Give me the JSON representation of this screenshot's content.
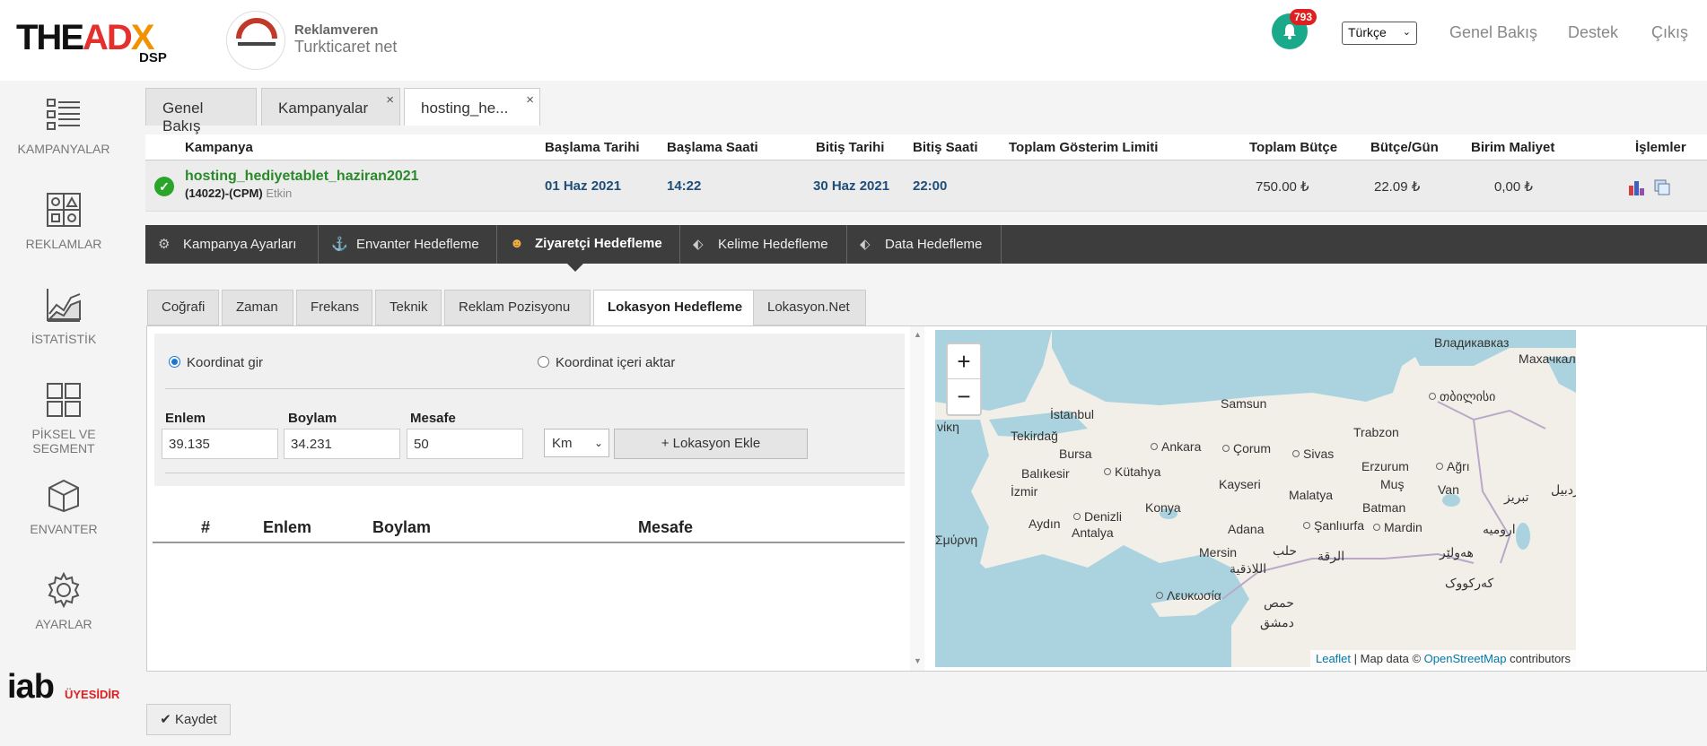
{
  "header": {
    "logo_the": "THE",
    "logo_ad": "AD",
    "logo_x": "X",
    "logo_dsp": "DSP",
    "advertiser_label": "Reklamveren",
    "advertiser_name": "Turkticaret net",
    "notification_count": "793",
    "language": "Türkçe",
    "links": [
      "Genel Bakış",
      "Destek",
      "Çıkış"
    ]
  },
  "sidebar": {
    "items": [
      {
        "label": "KAMPANYALAR",
        "icon": "campaigns-list-icon"
      },
      {
        "label": "REKLAMLAR",
        "icon": "ads-grid-icon"
      },
      {
        "label": "İSTATİSTİK",
        "icon": "statistics-chart-icon"
      },
      {
        "label": "PİKSEL VE SEGMENT",
        "icon": "pixel-segment-icon"
      },
      {
        "label": "ENVANTER",
        "icon": "inventory-box-icon"
      },
      {
        "label": "AYARLAR",
        "icon": "gear-icon"
      }
    ],
    "iab": "iab",
    "iab_sub": "ÜYESİDİR"
  },
  "page_tabs": [
    {
      "label": "Genel Bakış"
    },
    {
      "label": "Kampanyalar"
    },
    {
      "label": "hosting_he..."
    }
  ],
  "campaign_table": {
    "headers": [
      "Kampanya",
      "Başlama Tarihi",
      "Başlama Saati",
      "Bitiş Tarihi",
      "Bitiş Saati",
      "Toplam Gösterim Limiti",
      "Toplam Bütçe",
      "Bütçe/Gün",
      "Birim Maliyet",
      "İşlemler"
    ],
    "row": {
      "name": "hosting_hediyetablet_haziran2021",
      "sub": "(14022)-(CPM)",
      "status": "Etkin",
      "start_date": "01 Haz 2021",
      "start_time": "14:22",
      "end_date": "30 Haz 2021",
      "end_time": "22:00",
      "impression_limit": "",
      "total_budget": "750.00 ₺",
      "daily_budget": "22.09 ₺",
      "unit_cost": "0,00 ₺"
    }
  },
  "section_tabs": [
    {
      "label": "Kampanya Ayarları",
      "icon": "gear-icon"
    },
    {
      "label": "Envanter Hedefleme",
      "icon": "anchor-icon"
    },
    {
      "label": "Ziyaretçi Hedefleme",
      "icon": "visitor-icon"
    },
    {
      "label": "Kelime Hedefleme",
      "icon": "tag-icon"
    },
    {
      "label": "Data Hedefleme",
      "icon": "tags-icon"
    }
  ],
  "sub_tabs": [
    {
      "label": "Coğrafi"
    },
    {
      "label": "Zaman"
    },
    {
      "label": "Frekans"
    },
    {
      "label": "Teknik"
    },
    {
      "label": "Reklam Pozisyonu"
    },
    {
      "label": "Lokasyon Hedefleme"
    },
    {
      "label": "Lokasyon.Net"
    }
  ],
  "location_form": {
    "radio_manual": "Koordinat gir",
    "radio_import": "Koordinat içeri aktar",
    "lat_label": "Enlem",
    "lat_value": "39.135",
    "lng_label": "Boylam",
    "lng_value": "34.231",
    "dist_label": "Mesafe",
    "dist_value": "50",
    "unit": "Km",
    "add_button": "+ Lokasyon Ekle"
  },
  "location_table": {
    "headers": [
      "#",
      "Enlem",
      "Boylam",
      "Mesafe"
    ]
  },
  "map": {
    "zoom_in": "+",
    "zoom_out": "−",
    "attribution_leaflet": "Leaflet",
    "attribution_mid": "| Map data ©",
    "attribution_osm": "OpenStreetMap",
    "attribution_end": "contributors",
    "labels": [
      "Владикавказ",
      "Махачкал",
      "İstanbul",
      "Samsun",
      "თბილისი",
      "Tekirdağ",
      "Trabzon",
      "Ankara",
      "Çorum",
      "Sivas",
      "Bursa",
      "Erzurum",
      "Ağrı",
      "Balıkesir",
      "Kütahya",
      "Kayseri",
      "Muş",
      "İzmir",
      "Malatya",
      "Van",
      "Konya",
      "Batman",
      "Aydın",
      "Denizli",
      "Antalya",
      "Adana",
      "Şanlıurfa",
      "Mardin",
      "Mersin",
      "حلب",
      "الرقة",
      "اللاذقية",
      "Λευκωσία",
      "حمص",
      "دمشق",
      "ارومیه",
      "تبریز",
      "اردبیل",
      "هەولێر",
      "کەرکووک",
      "νίκη",
      "Σμύρνη"
    ]
  },
  "save_button": "Kaydet",
  "colors": {
    "accent_green": "#2a8a2a",
    "teal": "#1aaa8b",
    "dark_bar": "#3d3d3d",
    "link_blue": "#1f4e79",
    "sea": "#aad3df"
  }
}
